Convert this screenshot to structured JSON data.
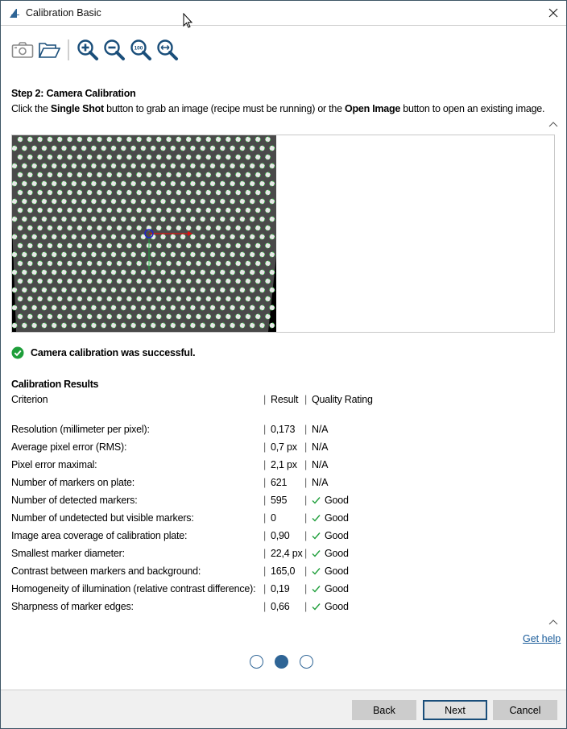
{
  "window": {
    "title": "Calibration Basic",
    "close_icon": "close-icon",
    "app_icon": "app-logo-icon"
  },
  "toolbar": {
    "buttons": [
      {
        "name": "single-shot",
        "icon": "camera-icon"
      },
      {
        "name": "open-image",
        "icon": "folder-open-icon"
      },
      {
        "name": "zoom-in",
        "icon": "zoom-in-icon"
      },
      {
        "name": "zoom-out",
        "icon": "zoom-out-icon"
      },
      {
        "name": "zoom-100",
        "icon": "zoom-100-icon",
        "label": "100"
      },
      {
        "name": "zoom-fit",
        "icon": "zoom-fit-icon"
      }
    ]
  },
  "step": {
    "title": "Step 2: Camera Calibration",
    "desc_1": "Click the ",
    "desc_bold_1": "Single Shot",
    "desc_2": " button to grab an image (recipe must be running) or the ",
    "desc_bold_2": "Open Image",
    "desc_3": " button to open an existing image."
  },
  "status": {
    "icon": "check-circle-icon",
    "text": "Camera calibration was successful.",
    "color": "#1e9e3a"
  },
  "results": {
    "title": "Calibration Results",
    "header": {
      "criterion": "Criterion",
      "result": "Result",
      "quality": "Quality Rating",
      "separator": "|"
    },
    "rows": [
      {
        "criterion": "Resolution (millimeter per pixel):",
        "result": "0,173",
        "quality": "N/A",
        "check": false
      },
      {
        "criterion": "Average pixel error (RMS):",
        "result": "0,7 px",
        "quality": "N/A",
        "check": false
      },
      {
        "criterion": "Pixel error maximal:",
        "result": "2,1 px",
        "quality": "N/A",
        "check": false
      },
      {
        "criterion": "Number of markers on plate:",
        "result": "621",
        "quality": "N/A",
        "check": false
      },
      {
        "criterion": "Number of detected markers:",
        "result": "595",
        "quality": "Good",
        "check": true
      },
      {
        "criterion": "Number of undetected but visible markers:",
        "result": "0",
        "quality": "Good",
        "check": true
      },
      {
        "criterion": "Image area coverage of calibration plate:",
        "result": "0,90",
        "quality": "Good",
        "check": true
      },
      {
        "criterion": "Smallest marker diameter:",
        "result": "22,4 px",
        "quality": "Good",
        "check": true
      },
      {
        "criterion": "Contrast between markers and background:",
        "result": "165,0",
        "quality": "Good",
        "check": true
      },
      {
        "criterion": "Homogeneity of illumination (relative contrast difference):",
        "result": "0,19",
        "quality": "Good",
        "check": true
      },
      {
        "criterion": "Sharpness of marker edges:",
        "result": "0,66",
        "quality": "Good",
        "check": true
      }
    ]
  },
  "help": {
    "label": "Get help"
  },
  "pager": {
    "total": 3,
    "current": 2
  },
  "footer": {
    "back": "Back",
    "next": "Next",
    "cancel": "Cancel"
  },
  "colors": {
    "accent": "#2f6596",
    "good": "#1e9e3a",
    "link": "#1a5c9a",
    "icon_blue": "#1a4e7a"
  }
}
